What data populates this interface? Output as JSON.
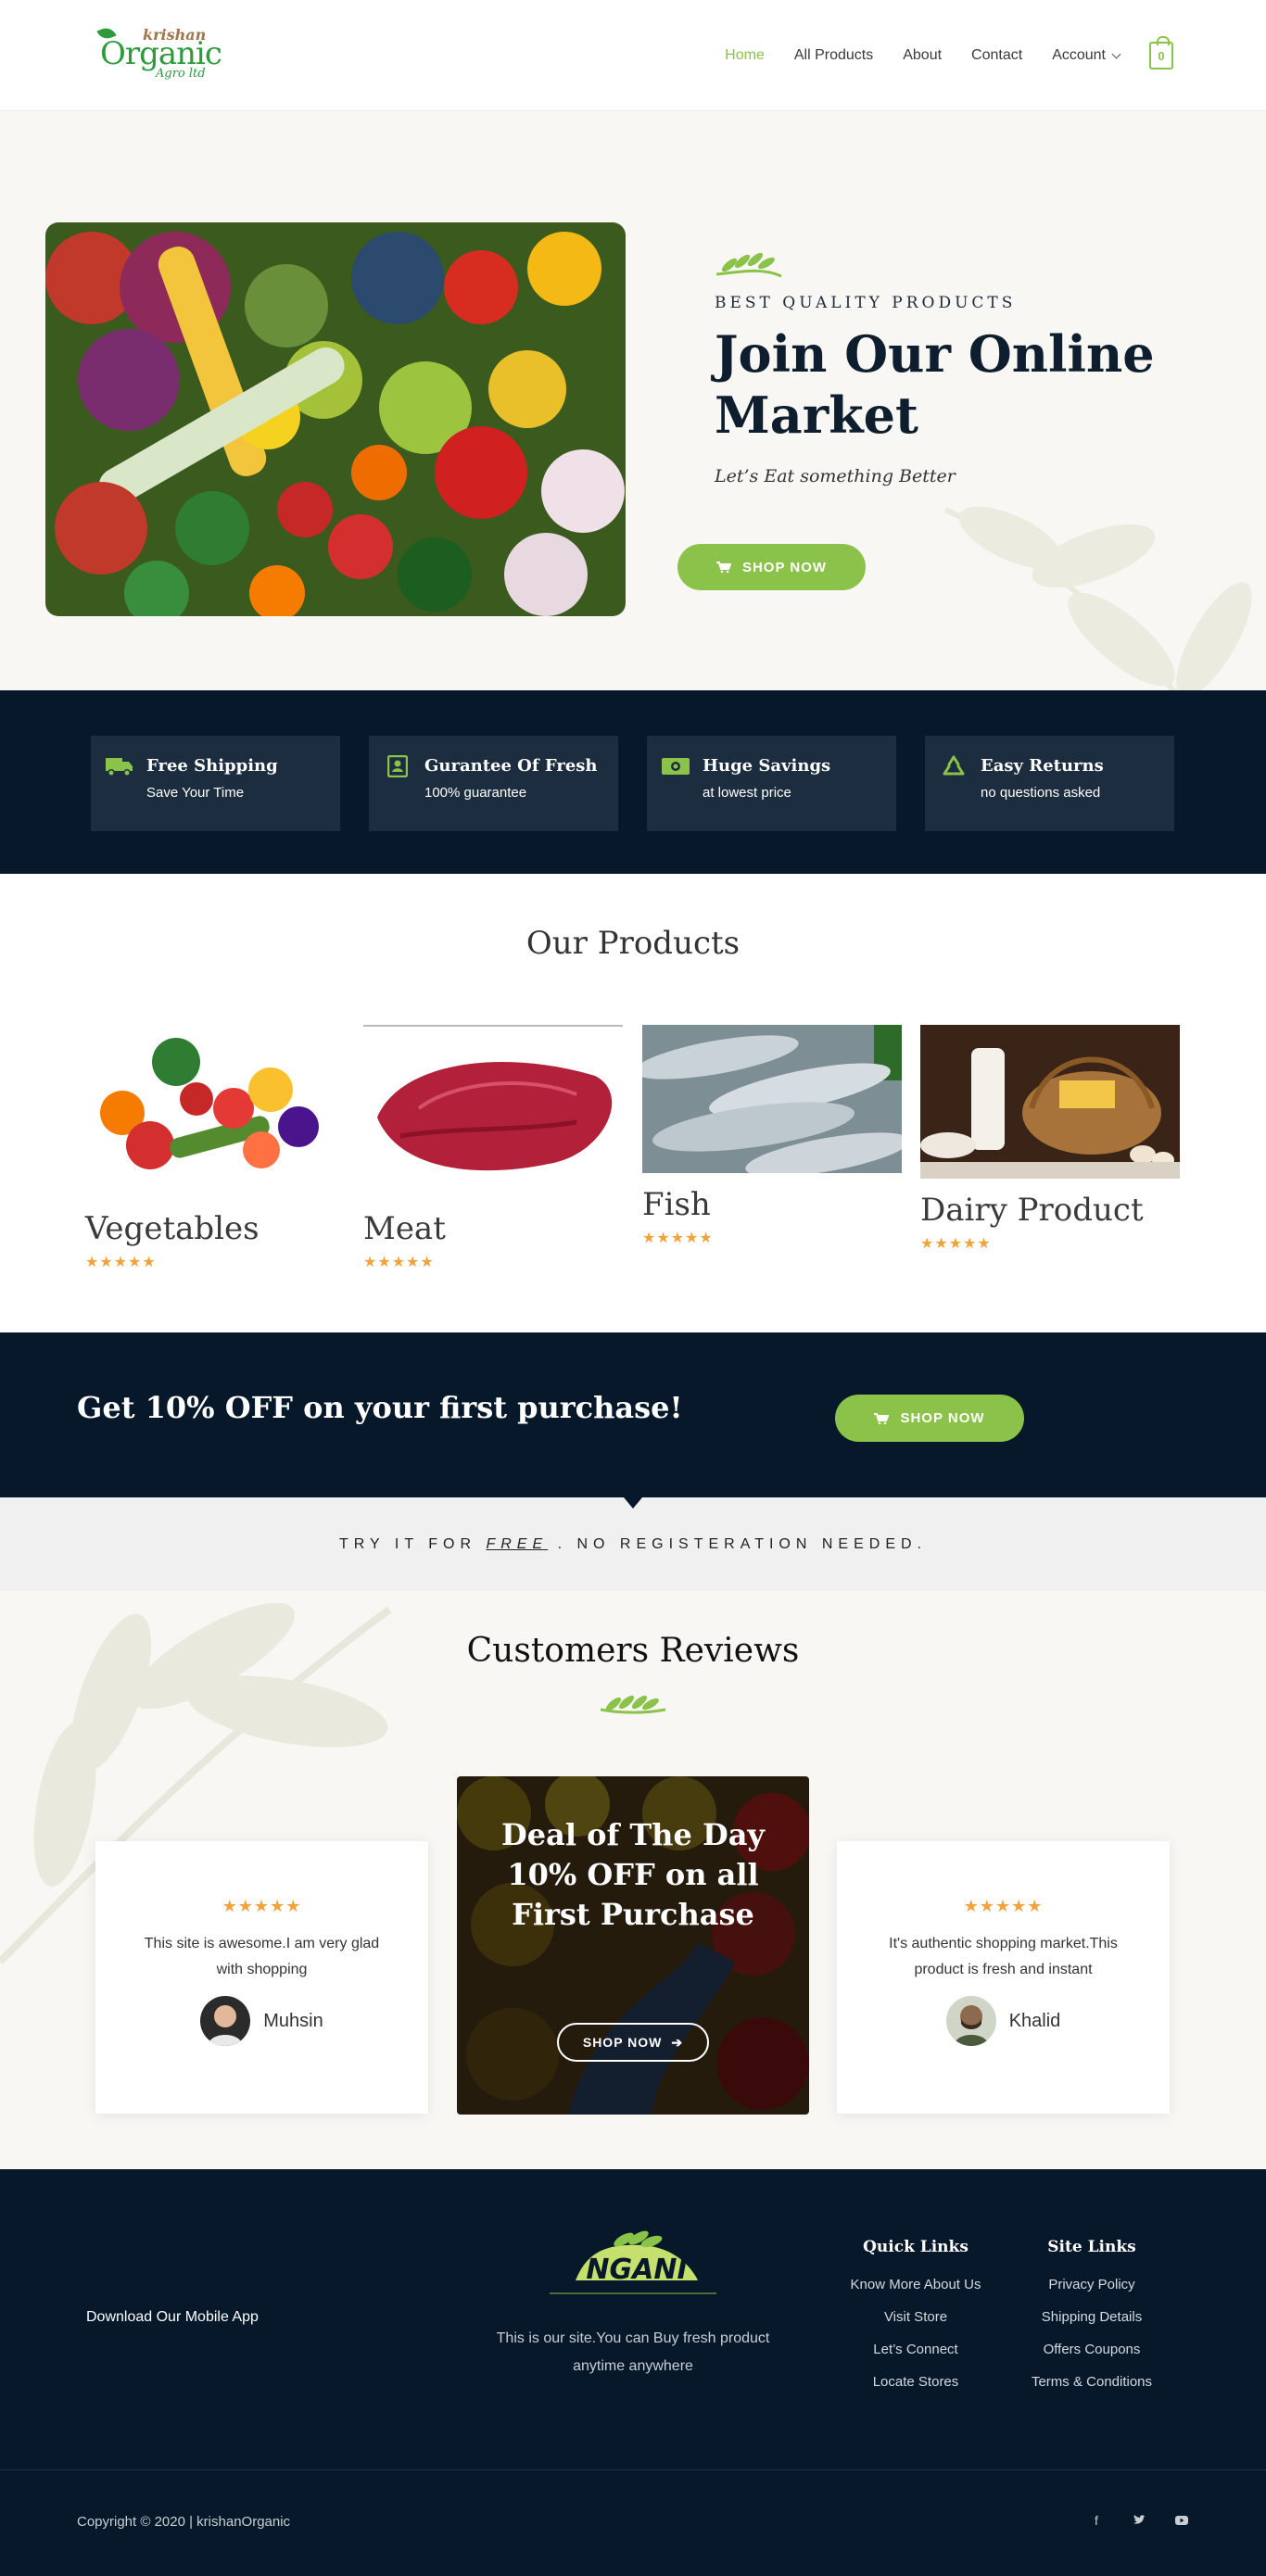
{
  "header": {
    "logo": {
      "line1": "krishan",
      "line2": "Organic",
      "line3": "Agro ltd"
    },
    "nav": [
      "Home",
      "All Products",
      "About",
      "Contact",
      "Account"
    ],
    "cart_count": "0"
  },
  "hero": {
    "eyebrow": "BEST QUALITY PRODUCTS",
    "title_line1": "Join Our Online",
    "title_line2": "Market",
    "subtitle": "Let’s Eat something Better",
    "cta": "SHOP NOW"
  },
  "features": [
    {
      "icon": "truck-icon",
      "title": "Free Shipping",
      "subtitle": "Save Your Time"
    },
    {
      "icon": "contact-card-icon",
      "title": "Gurantee Of Fresh",
      "subtitle": "100% guarantee"
    },
    {
      "icon": "money-icon",
      "title": "Huge Savings",
      "subtitle": "at lowest price"
    },
    {
      "icon": "recycle-icon",
      "title": "Easy Returns",
      "subtitle": "no questions asked"
    }
  ],
  "products": {
    "title": "Our Products",
    "items": [
      {
        "name": "Vegetables",
        "rating": "★★★★★"
      },
      {
        "name": "Meat",
        "rating": "★★★★★"
      },
      {
        "name": "Fish",
        "rating": "★★★★★"
      },
      {
        "name": "Dairy Product",
        "rating": "★★★★★"
      }
    ]
  },
  "offer": {
    "text": "Get 10% OFF on your first purchase!",
    "cta": "SHOP NOW"
  },
  "try_banner": {
    "pre": "TRY IT FOR ",
    "free": "FREE",
    "post": " . NO REGISTERATION NEEDED."
  },
  "reviews": {
    "title": "Customers Reviews",
    "left": {
      "rating": "★★★★★",
      "text": "This site is awesome.I am very glad with shopping",
      "name": "Muhsin"
    },
    "right": {
      "rating": "★★★★★",
      "text": "It's authentic shopping market.This product is fresh and instant",
      "name": "Khalid"
    },
    "deal": {
      "line1": "Deal of The Day",
      "line2": "10% OFF on all",
      "line3": "First Purchase",
      "cta": "SHOP NOW"
    }
  },
  "footer": {
    "download": "Download Our Mobile App",
    "logo_text": "NGANI",
    "description": "This is our site.You can Buy fresh product anytime anywhere",
    "quick_links": {
      "title": "Quick Links",
      "items": [
        "Know More About Us",
        "Visit Store",
        "Let’s Connect",
        "Locate Stores"
      ]
    },
    "site_links": {
      "title": "Site Links",
      "items": [
        "Privacy Policy",
        "Shipping Details",
        "Offers Coupons",
        "Terms & Conditions"
      ]
    },
    "copyright": "Copyright © 2020 | krishanOrganic",
    "social": [
      "f",
      "t",
      "yt"
    ]
  },
  "colors": {
    "accent": "#8bc34a",
    "navy": "#06182a",
    "star": "#f0a33a"
  }
}
